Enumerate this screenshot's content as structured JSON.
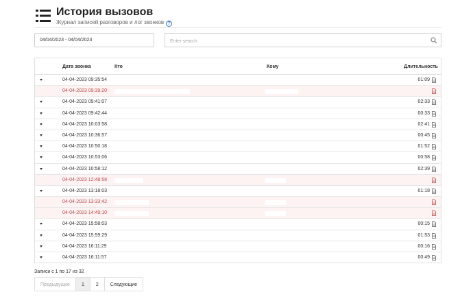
{
  "header": {
    "title": "История вызовов",
    "subtitle": "Журнал записей разговоров и лог звонков",
    "help_label": "?"
  },
  "filters": {
    "date_range": "04/04/2023 - 04/04/2023",
    "search_placeholder": "Enter search"
  },
  "table": {
    "headers": {
      "date": "Дата звонка",
      "from": "Кто",
      "to": "Кому",
      "duration": "Длительность"
    },
    "rows": [
      {
        "date": "04-04-2023 09:35:54",
        "duration": "01:09",
        "missed": false,
        "from_w": 0,
        "to_w": 0
      },
      {
        "date": "04-04-2023 09:39:20",
        "duration": "",
        "missed": true,
        "from_w": 110,
        "to_w": 48
      },
      {
        "date": "04-04-2023 09:41:07",
        "duration": "02:33",
        "missed": false,
        "from_w": 0,
        "to_w": 0
      },
      {
        "date": "04-04-2023 09:42:44",
        "duration": "00:33",
        "missed": false,
        "from_w": 0,
        "to_w": 0
      },
      {
        "date": "04-04-2023 10:03:58",
        "duration": "02:41",
        "missed": false,
        "from_w": 0,
        "to_w": 0
      },
      {
        "date": "04-04-2023 10:36:57",
        "duration": "00:45",
        "missed": false,
        "from_w": 0,
        "to_w": 0
      },
      {
        "date": "04-04-2023 10:50:18",
        "duration": "01:52",
        "missed": false,
        "from_w": 0,
        "to_w": 0
      },
      {
        "date": "04-04-2023 10:53:06",
        "duration": "00:58",
        "missed": false,
        "from_w": 0,
        "to_w": 0
      },
      {
        "date": "04-04-2023 10:58:12",
        "duration": "02:39",
        "missed": false,
        "from_w": 0,
        "to_w": 0
      },
      {
        "date": "04-04-2023 12:48:58",
        "duration": "",
        "missed": true,
        "from_w": 42,
        "to_w": 30
      },
      {
        "date": "04-04-2023 13:18:03",
        "duration": "01:18",
        "missed": false,
        "from_w": 0,
        "to_w": 0
      },
      {
        "date": "04-04-2023 13:33:42",
        "duration": "",
        "missed": true,
        "from_w": 50,
        "to_w": 30
      },
      {
        "date": "04-04-2023 14:49:10",
        "duration": "",
        "missed": true,
        "from_w": 50,
        "to_w": 30
      },
      {
        "date": "04-04-2023 15:58:03",
        "duration": "00:15",
        "missed": false,
        "from_w": 0,
        "to_w": 0
      },
      {
        "date": "04-04-2023 15:59:29",
        "duration": "01:53",
        "missed": false,
        "from_w": 0,
        "to_w": 0
      },
      {
        "date": "04-04-2023 16:11:29",
        "duration": "00:16",
        "missed": false,
        "from_w": 0,
        "to_w": 0
      },
      {
        "date": "04-04-2023 16:11:57",
        "duration": "00:49",
        "missed": false,
        "from_w": 0,
        "to_w": 0
      }
    ]
  },
  "info": "Записи с 1 по 17 из 32",
  "pagination": {
    "prev": "Предыдущие",
    "pages": [
      "1",
      "2"
    ],
    "next": "Следующие"
  },
  "colors": {
    "accent": "#3a77c4",
    "missed_bg": "#fdf3f3",
    "missed_text": "#b94a48"
  }
}
